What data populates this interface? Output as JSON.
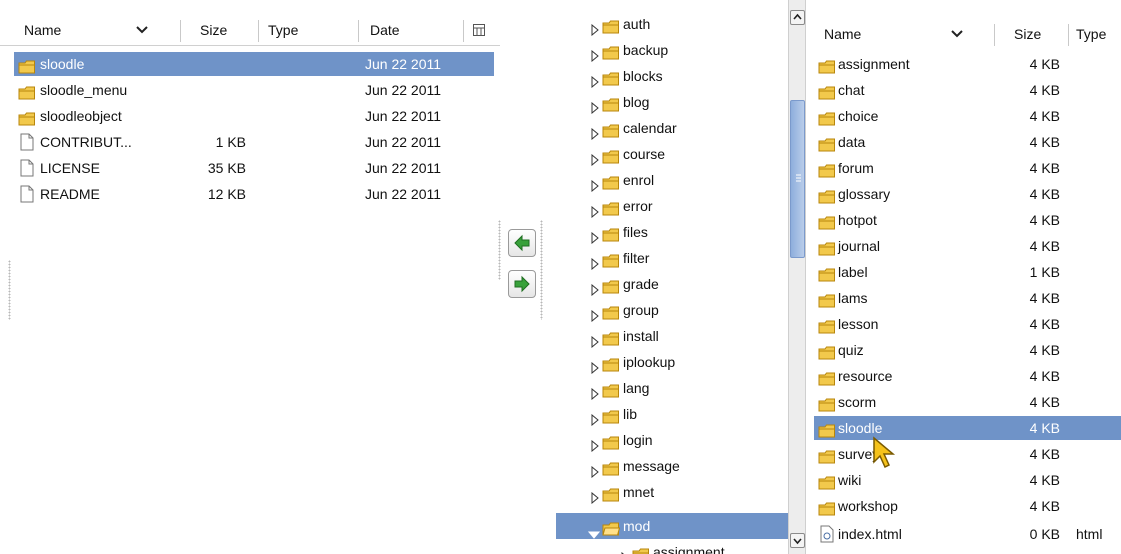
{
  "left_panel": {
    "columns": {
      "name": "Name",
      "size": "Size",
      "type": "Type",
      "date": "Date"
    },
    "rows": [
      {
        "name": "sloodle",
        "size": "",
        "date": "Jun 22 2011",
        "kind": "folder",
        "selected": true
      },
      {
        "name": "sloodle_menu",
        "size": "",
        "date": "Jun 22 2011",
        "kind": "folder",
        "selected": false
      },
      {
        "name": "sloodleobject",
        "size": "",
        "date": "Jun 22 2011",
        "kind": "folder",
        "selected": false
      },
      {
        "name": "CONTRIBUT...",
        "size": "1 KB",
        "date": "Jun 22 2011",
        "kind": "file",
        "selected": false
      },
      {
        "name": "LICENSE",
        "size": "35 KB",
        "date": "Jun 22 2011",
        "kind": "file",
        "selected": false
      },
      {
        "name": "README",
        "size": "12 KB",
        "date": "Jun 22 2011",
        "kind": "file",
        "selected": false
      }
    ]
  },
  "transfer": {
    "upload_icon": "arrow-left-icon",
    "download_icon": "arrow-right-icon"
  },
  "tree": {
    "items": [
      {
        "label": "auth",
        "expanded": false,
        "level": 0
      },
      {
        "label": "backup",
        "expanded": false,
        "level": 0
      },
      {
        "label": "blocks",
        "expanded": false,
        "level": 0
      },
      {
        "label": "blog",
        "expanded": false,
        "level": 0
      },
      {
        "label": "calendar",
        "expanded": false,
        "level": 0
      },
      {
        "label": "course",
        "expanded": false,
        "level": 0
      },
      {
        "label": "enrol",
        "expanded": false,
        "level": 0
      },
      {
        "label": "error",
        "expanded": false,
        "level": 0
      },
      {
        "label": "files",
        "expanded": false,
        "level": 0
      },
      {
        "label": "filter",
        "expanded": false,
        "level": 0
      },
      {
        "label": "grade",
        "expanded": false,
        "level": 0
      },
      {
        "label": "group",
        "expanded": false,
        "level": 0
      },
      {
        "label": "install",
        "expanded": false,
        "level": 0
      },
      {
        "label": "iplookup",
        "expanded": false,
        "level": 0
      },
      {
        "label": "lang",
        "expanded": false,
        "level": 0
      },
      {
        "label": "lib",
        "expanded": false,
        "level": 0
      },
      {
        "label": "login",
        "expanded": false,
        "level": 0
      },
      {
        "label": "message",
        "expanded": false,
        "level": 0
      },
      {
        "label": "mnet",
        "expanded": false,
        "level": 0
      },
      {
        "label": "mod",
        "expanded": true,
        "level": 0,
        "selected": true
      },
      {
        "label": "assignment",
        "expanded": false,
        "level": 1
      }
    ]
  },
  "right_panel": {
    "columns": {
      "name": "Name",
      "size": "Size",
      "type": "Type"
    },
    "rows": [
      {
        "name": "assignment",
        "size": "4 KB",
        "type": "",
        "kind": "folder"
      },
      {
        "name": "chat",
        "size": "4 KB",
        "type": "",
        "kind": "folder"
      },
      {
        "name": "choice",
        "size": "4 KB",
        "type": "",
        "kind": "folder"
      },
      {
        "name": "data",
        "size": "4 KB",
        "type": "",
        "kind": "folder"
      },
      {
        "name": "forum",
        "size": "4 KB",
        "type": "",
        "kind": "folder"
      },
      {
        "name": "glossary",
        "size": "4 KB",
        "type": "",
        "kind": "folder"
      },
      {
        "name": "hotpot",
        "size": "4 KB",
        "type": "",
        "kind": "folder"
      },
      {
        "name": "journal",
        "size": "4 KB",
        "type": "",
        "kind": "folder"
      },
      {
        "name": "label",
        "size": "1 KB",
        "type": "",
        "kind": "folder"
      },
      {
        "name": "lams",
        "size": "4 KB",
        "type": "",
        "kind": "folder"
      },
      {
        "name": "lesson",
        "size": "4 KB",
        "type": "",
        "kind": "folder"
      },
      {
        "name": "quiz",
        "size": "4 KB",
        "type": "",
        "kind": "folder"
      },
      {
        "name": "resource",
        "size": "4 KB",
        "type": "",
        "kind": "folder"
      },
      {
        "name": "scorm",
        "size": "4 KB",
        "type": "",
        "kind": "folder"
      },
      {
        "name": "sloodle",
        "size": "4 KB",
        "type": "",
        "kind": "folder",
        "selected": true
      },
      {
        "name": "survey",
        "size": "4 KB",
        "type": "",
        "kind": "folder"
      },
      {
        "name": "wiki",
        "size": "4 KB",
        "type": "",
        "kind": "folder"
      },
      {
        "name": "workshop",
        "size": "4 KB",
        "type": "",
        "kind": "folder"
      },
      {
        "name": "index.html",
        "size": "0 KB",
        "type": "html",
        "kind": "html"
      }
    ]
  },
  "colors": {
    "selection": "#6f93c8",
    "folder": "#f2c94c",
    "folder_stroke": "#b8860b"
  }
}
